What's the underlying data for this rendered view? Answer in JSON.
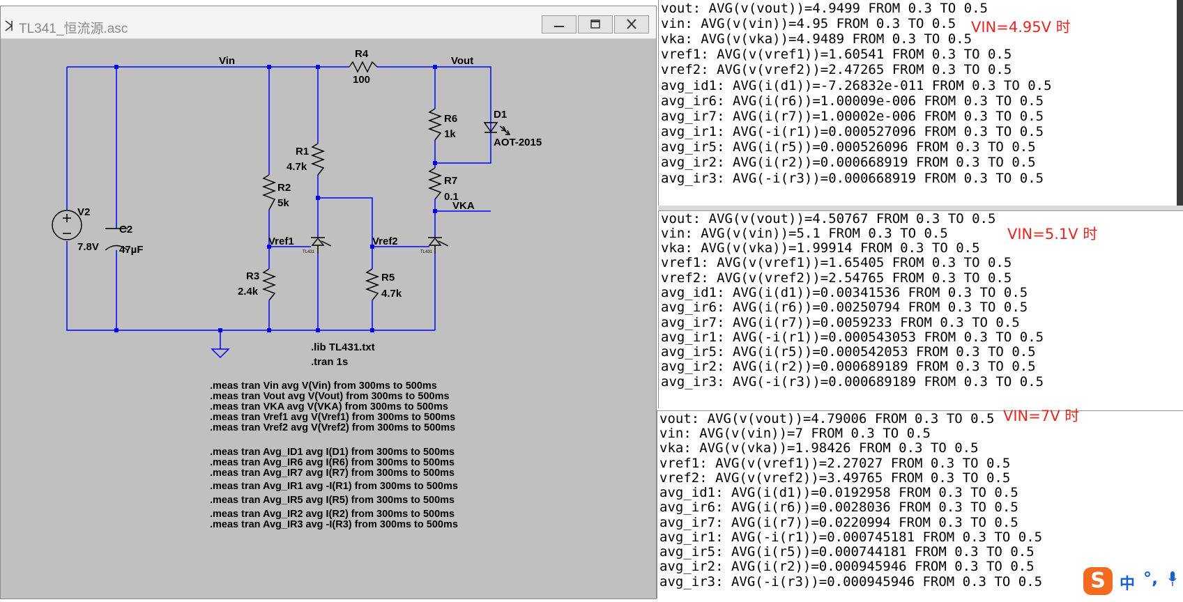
{
  "window": {
    "title": "TL341_恒流源.asc",
    "buttons": {
      "minimize": "minimize",
      "maximize": "maximize",
      "close": "close"
    }
  },
  "schematic": {
    "nets": {
      "vin": "Vin",
      "vout": "Vout",
      "vka": "VKA",
      "vref1": "Vref1",
      "vref2": "Vref2"
    },
    "components": {
      "r4_name": "R4",
      "r4_value": "100",
      "r6_name": "R6",
      "r6_value": "1k",
      "r7_name": "R7",
      "r7_value": "0.1",
      "r1_name": "R1",
      "r1_value": "4.7k",
      "r2_name": "R2",
      "r2_value": "5k",
      "r3_name": "R3",
      "r3_value": "2.4k",
      "r5_name": "R5",
      "r5_value": "4.7k",
      "d1_name": "D1",
      "d1_value": "AOT-2015",
      "v2_name": "V2",
      "v2_value": "7.8V",
      "c2_name": "C2",
      "c2_value": "47µF",
      "u1_label": "TL431",
      "u2_label": "TL431"
    },
    "directives": {
      "lib": ".lib TL431.txt",
      "tran": ".tran 1s"
    },
    "meas_commands": [
      ".meas tran Vin avg V(Vin) from 300ms to 500ms",
      ".meas tran Vout avg V(Vout) from 300ms to 500ms",
      ".meas tran VKA avg V(VKA) from 300ms to 500ms",
      ".meas tran Vref1 avg V(Vref1) from 300ms to 500ms",
      ".meas tran Vref2 avg V(Vref2) from 300ms to 500ms",
      ".meas tran Avg_ID1 avg I(D1) from 300ms to 500ms",
      ".meas tran Avg_IR6 avg I(R6) from 300ms to 500ms",
      ".meas tran Avg_IR7 avg I(R7) from 300ms to 500ms",
      ".meas tran Avg_IR1 avg -I(R1) from 300ms to 500ms",
      ".meas tran Avg_IR5 avg I(R5) from 300ms to 500ms",
      ".meas tran Avg_IR2 avg I(R2) from 300ms to 500ms",
      ".meas tran Avg_IR3 avg -I(R3) from 300ms to 500ms"
    ]
  },
  "results": [
    {
      "note": "VIN=4.95V 时",
      "lines": [
        "vout: AVG(v(vout))=4.9499 FROM 0.3 TO 0.5",
        "vin: AVG(v(vin))=4.95 FROM 0.3 TO 0.5",
        "vka: AVG(v(vka))=4.9489 FROM 0.3 TO 0.5",
        "vref1: AVG(v(vref1))=1.60541 FROM 0.3 TO 0.5",
        "vref2: AVG(v(vref2))=2.47265 FROM 0.3 TO 0.5",
        "avg_id1: AVG(i(d1))=-7.26832e-011 FROM 0.3 TO 0.5",
        "avg_ir6: AVG(i(r6))=1.00009e-006 FROM 0.3 TO 0.5",
        "avg_ir7: AVG(i(r7))=1.00002e-006 FROM 0.3 TO 0.5",
        "avg_ir1: AVG(-i(r1))=0.000527096 FROM 0.3 TO 0.5",
        "avg_ir5: AVG(i(r5))=0.000526096 FROM 0.3 TO 0.5",
        "avg_ir2: AVG(i(r2))=0.000668919 FROM 0.3 TO 0.5",
        "avg_ir3: AVG(-i(r3))=0.000668919 FROM 0.3 TO 0.5"
      ]
    },
    {
      "note": "VIN=5.1V 时",
      "lines": [
        "vout: AVG(v(vout))=4.50767 FROM 0.3 TO 0.5",
        "vin: AVG(v(vin))=5.1 FROM 0.3 TO 0.5",
        "vka: AVG(v(vka))=1.99914 FROM 0.3 TO 0.5",
        "vref1: AVG(v(vref1))=1.65405 FROM 0.3 TO 0.5",
        "vref2: AVG(v(vref2))=2.54765 FROM 0.3 TO 0.5",
        "avg_id1: AVG(i(d1))=0.00341536 FROM 0.3 TO 0.5",
        "avg_ir6: AVG(i(r6))=0.00250794 FROM 0.3 TO 0.5",
        "avg_ir7: AVG(i(r7))=0.0059233 FROM 0.3 TO 0.5",
        "avg_ir1: AVG(-i(r1))=0.000543053 FROM 0.3 TO 0.5",
        "avg_ir5: AVG(i(r5))=0.000542053 FROM 0.3 TO 0.5",
        "avg_ir2: AVG(i(r2))=0.000689189 FROM 0.3 TO 0.5",
        "avg_ir3: AVG(-i(r3))=0.000689189 FROM 0.3 TO 0.5"
      ]
    },
    {
      "note": "VIN=7V 时",
      "lines": [
        "vout: AVG(v(vout))=4.79006 FROM 0.3 TO 0.5",
        "vin: AVG(v(vin))=7 FROM 0.3 TO 0.5",
        "vka: AVG(v(vka))=1.98426 FROM 0.3 TO 0.5",
        "vref1: AVG(v(vref1))=2.27027 FROM 0.3 TO 0.5",
        "vref2: AVG(v(vref2))=3.49765 FROM 0.3 TO 0.5",
        "avg_id1: AVG(i(d1))=0.0192958 FROM 0.3 TO 0.5",
        "avg_ir6: AVG(i(r6))=0.0028036 FROM 0.3 TO 0.5",
        "avg_ir7: AVG(i(r7))=0.0220994 FROM 0.3 TO 0.5",
        "avg_ir1: AVG(-i(r1))=0.000745181 FROM 0.3 TO 0.5",
        "avg_ir5: AVG(i(r5))=0.000744181 FROM 0.3 TO 0.5",
        "avg_ir2: AVG(i(r2))=0.000945946 FROM 0.3 TO 0.5",
        "avg_ir3: AVG(-i(r3))=0.000945946 FROM 0.3 TO 0.5"
      ]
    }
  ],
  "ime": {
    "logo": "S",
    "lang": "中",
    "punct": "°,"
  }
}
